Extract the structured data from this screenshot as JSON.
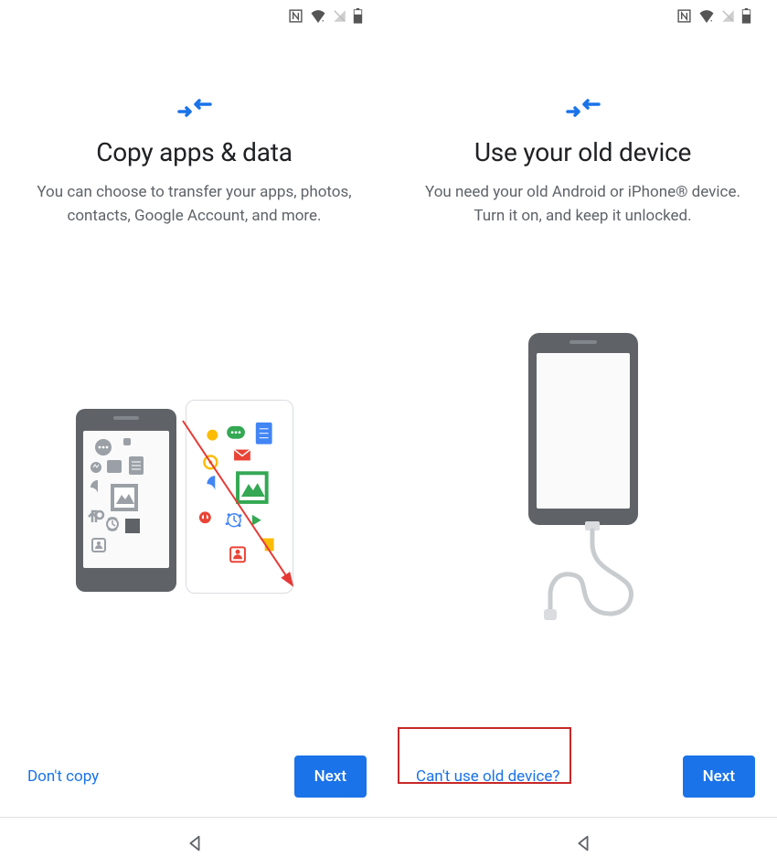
{
  "status_icons": [
    "nfc-icon",
    "wifi-icon",
    "signal-icon",
    "battery-icon"
  ],
  "left": {
    "title": "Copy apps & data",
    "subtitle": "You can choose to transfer your apps, photos, contacts, Google Account, and more.",
    "secondary_action": "Don't copy",
    "primary_action": "Next"
  },
  "right": {
    "title": "Use your old device",
    "subtitle": "You need your old Android or iPhone® device. Turn it on, and keep it unlocked.",
    "secondary_action": "Can't use old device?",
    "primary_action": "Next"
  },
  "colors": {
    "accent": "#1a73e8",
    "highlight": "#c62828",
    "text_secondary": "#5f6368"
  }
}
